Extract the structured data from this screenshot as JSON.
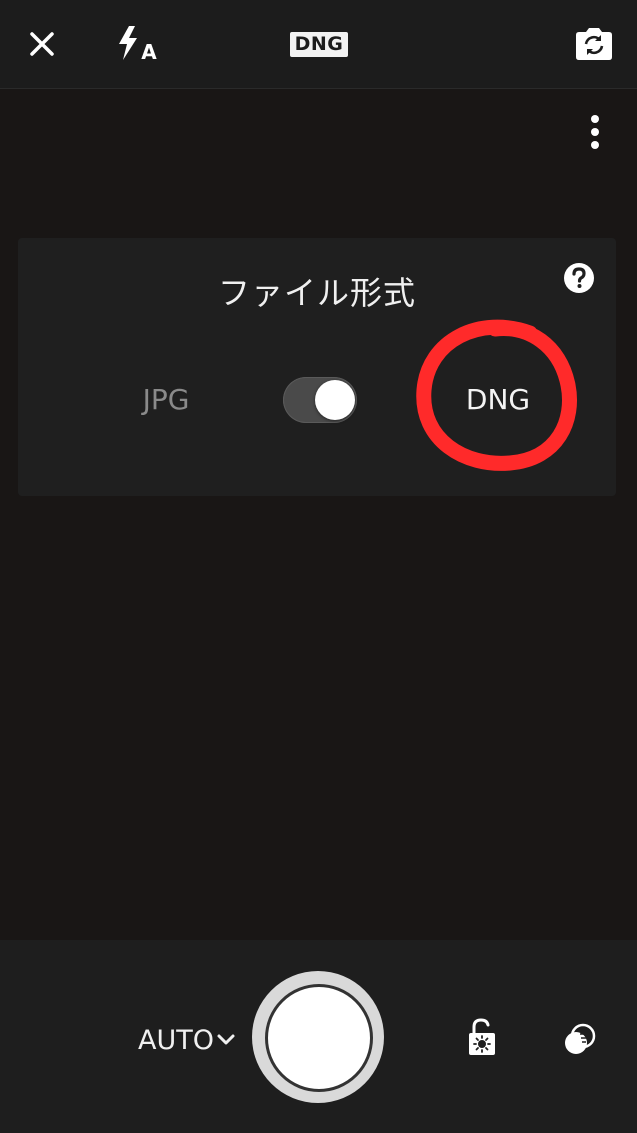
{
  "top_bar": {
    "close_icon": "close-icon",
    "flash_icon": "flash-auto-icon",
    "flash_mode_letter": "A",
    "format_badge": "DNG",
    "switch_camera_icon": "switch-camera-icon"
  },
  "viewfinder": {
    "more_icon": "more-vertical-icon"
  },
  "file_format_panel": {
    "title": "ファイル形式",
    "help_icon": "help-icon",
    "option_left": "JPG",
    "option_right": "DNG",
    "toggle_on": true,
    "selected": "DNG",
    "annotation_color": "#ff2a2a"
  },
  "bottom_bar": {
    "mode_label": "AUTO",
    "mode_chevron_icon": "chevron-down-icon",
    "shutter_icon": "shutter-button",
    "lock_icon": "exposure-lock-icon",
    "effects_icon": "effects-icon"
  },
  "colors": {
    "bar_background": "#1c1c1c",
    "viewfinder_background": "#191615",
    "panel_background": "#1f1f1f",
    "inactive_text": "#8a8a8a",
    "active_text": "#f4f4f4"
  }
}
